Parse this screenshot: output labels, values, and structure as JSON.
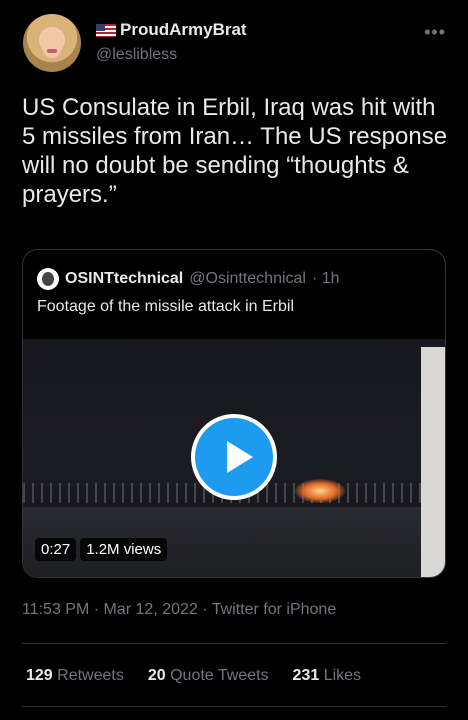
{
  "author": {
    "name": "ProudArmyBrat",
    "handle": "@leslibless",
    "name_icon": "us-flag-icon"
  },
  "tweet": {
    "text": "US Consulate in Erbil, Iraq was hit with 5 missiles from Iran… The US response will no doubt be sending “thoughts & prayers.”",
    "timestamp": "11:53 PM · Mar 12, 2022 · Twitter for iPhone"
  },
  "quoted_tweet": {
    "name": "OSINTtechnical",
    "handle": "@Osinttechnical",
    "age": "· 1h",
    "text": "Footage of the missile attack in Erbil",
    "video": {
      "duration": "0:27",
      "views": "1.2M views"
    }
  },
  "stats": {
    "retweets_count": "129",
    "retweets_label": "Retweets",
    "quotes_count": "20",
    "quotes_label": "Quote Tweets",
    "likes_count": "231",
    "likes_label": "Likes"
  },
  "colors": {
    "accent": "#1d9bf0",
    "background": "#000000",
    "secondary_text": "#71767b"
  }
}
